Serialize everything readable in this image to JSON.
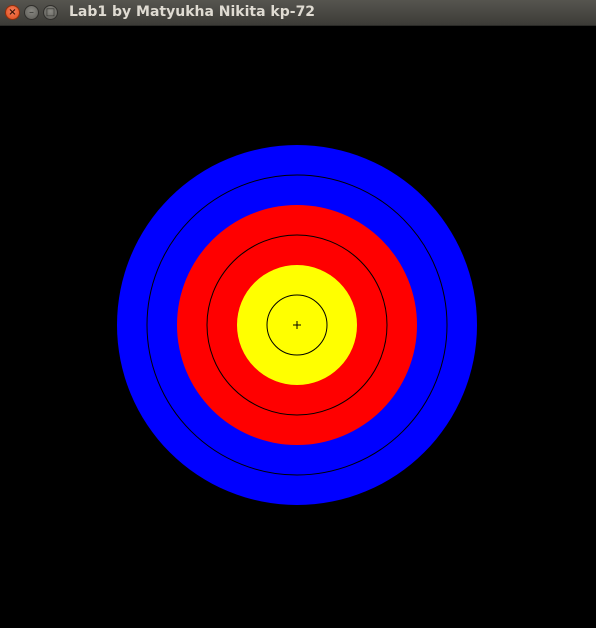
{
  "window": {
    "title": "Lab1 by Matyukha Nikita kp-72",
    "buttons": {
      "close_icon": "close-icon",
      "minimize_icon": "minimize-icon",
      "maximize_icon": "maximize-icon",
      "close_glyph": "×",
      "minimize_glyph": "–",
      "maximize_glyph": "□"
    }
  },
  "target": {
    "background_color": "#000000",
    "rings": [
      {
        "name": "outer-blue",
        "color": "#0000ff"
      },
      {
        "name": "outer-red",
        "color": "#ff0000"
      },
      {
        "name": "center-yellow",
        "color": "#ffff00"
      }
    ],
    "outline_color": "#000000",
    "center_mark": "+"
  }
}
